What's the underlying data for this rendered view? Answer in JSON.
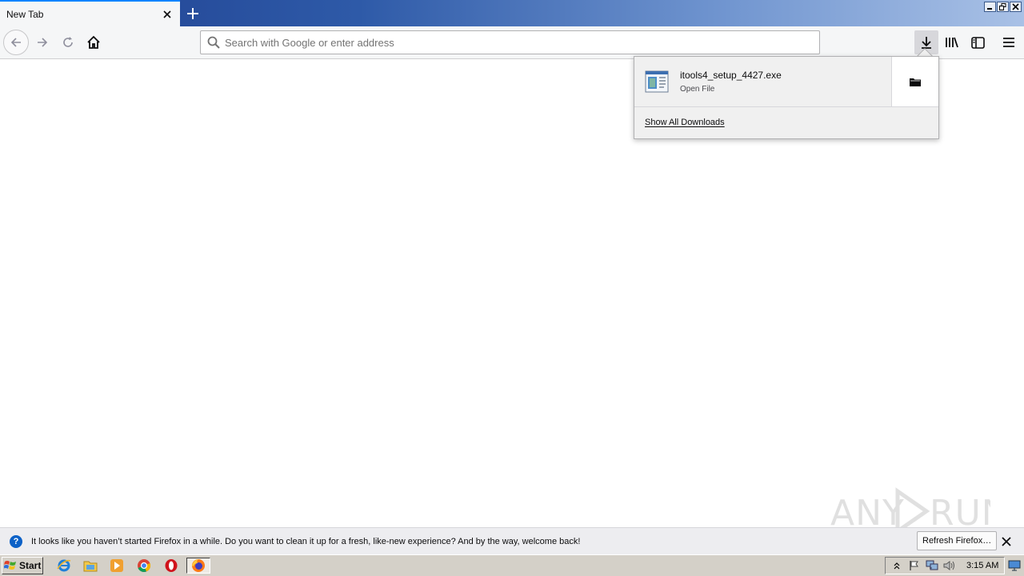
{
  "browser": {
    "tab": {
      "title": "New Tab"
    },
    "urlbar": {
      "placeholder": "Search with Google or enter address",
      "value": ""
    }
  },
  "downloads_panel": {
    "item": {
      "filename": "itools4_setup_4427.exe",
      "status": "Open File"
    },
    "show_all_label": "Show All Downloads"
  },
  "notification": {
    "message": "It looks like you haven’t started Firefox in a while. Do you want to clean it up for a fresh, like-new experience? And by the way, welcome back!",
    "refresh_label": "Refresh Firefox…"
  },
  "watermark": {
    "text": "ANY RUN"
  },
  "taskbar": {
    "start_label": "Start",
    "apps": [
      "internet-explorer-icon",
      "explorer-folder-icon",
      "media-player-icon",
      "chrome-icon",
      "opera-icon",
      "firefox-icon"
    ],
    "clock": "3:15 AM"
  },
  "colors": {
    "accent": "#0a84ff",
    "titlebar_start": "#1f3f8f",
    "titlebar_end": "#a9c1e6",
    "taskbar": "#d4d0c8"
  }
}
